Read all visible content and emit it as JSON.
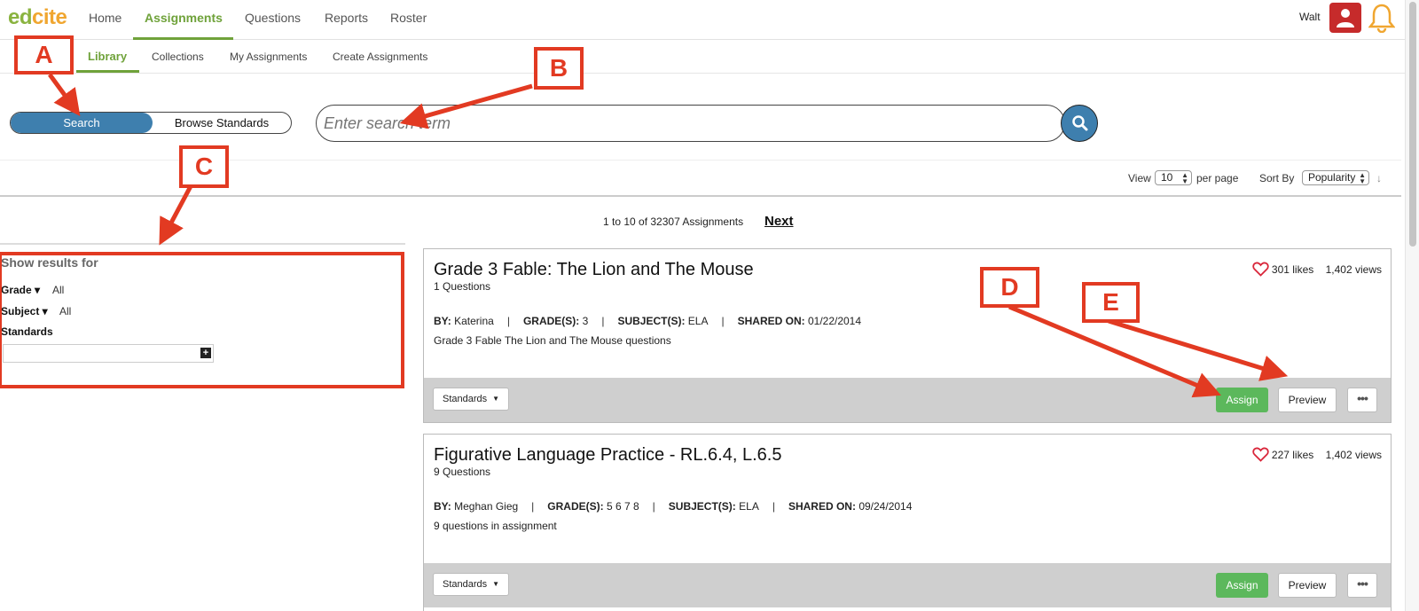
{
  "brand": {
    "logo_part1": "ed",
    "logo_part2": "cite"
  },
  "nav": {
    "items": [
      "Home",
      "Assignments",
      "Questions",
      "Reports",
      "Roster"
    ],
    "active": "Assignments"
  },
  "user": {
    "name": "Walt"
  },
  "subnav": {
    "items": [
      "Library",
      "Collections",
      "My Assignments",
      "Create Assignments"
    ],
    "active": "Library"
  },
  "search": {
    "toggle_search": "Search",
    "toggle_browse": "Browse Standards",
    "placeholder": "Enter search term"
  },
  "results_controls": {
    "view_label": "View",
    "per_page_value": "10",
    "per_page_label": "per page",
    "sort_label": "Sort By",
    "sort_value": "Popularity"
  },
  "paging": {
    "summary": "1 to 10 of 32307 Assignments",
    "next_label": "Next"
  },
  "filters": {
    "title": "Show results for",
    "grade_label": "Grade ▾",
    "grade_value": "All",
    "subject_label": "Subject ▾",
    "subject_value": "All",
    "standards_label": "Standards"
  },
  "labels": {
    "by": "BY:",
    "grades": "GRADE(S):",
    "subjects": "SUBJECT(S):",
    "shared": "SHARED ON:",
    "standards_btn": "Standards",
    "assign_btn": "Assign",
    "preview_btn": "Preview",
    "more_btn": "•••"
  },
  "assignments": [
    {
      "title": "Grade 3 Fable: The Lion and The Mouse",
      "questions": "1 Questions",
      "likes": "301 likes",
      "views": "1,402 views",
      "author": "Katerina",
      "grades": "3",
      "subject": "ELA",
      "shared_on": "01/22/2014",
      "description": "Grade 3 Fable The Lion and The Mouse questions"
    },
    {
      "title": "Figurative Language Practice - RL.6.4, L.6.5",
      "questions": "9 Questions",
      "likes": "227 likes",
      "views": "1,402 views",
      "author": "Meghan Gieg",
      "grades": "5 6 7 8",
      "subject": "ELA",
      "shared_on": "09/24/2014",
      "description": "9 questions in assignment"
    }
  ],
  "annotations": {
    "a": "A",
    "b": "B",
    "c": "C",
    "d": "D",
    "e": "E"
  },
  "colors": {
    "accent_green": "#6fa23a",
    "search_blue": "#3e7fae",
    "assign_green": "#5cb85c",
    "annotation_red": "#e23a22"
  }
}
